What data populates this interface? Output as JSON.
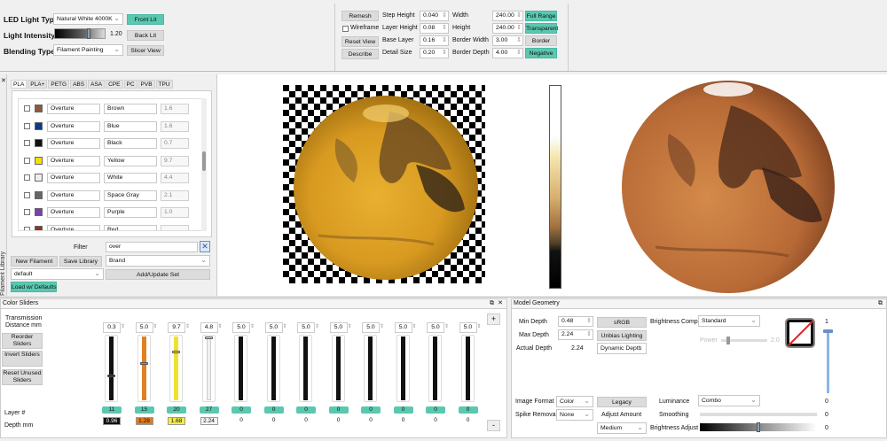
{
  "top_left": {
    "led_label": "LED Light Type",
    "led_value": "Natural White 4000K",
    "front_lit": "Front Lit",
    "intensity_label": "Light Intensity",
    "intensity_value": "1.20",
    "back_lit": "Back Lit",
    "blending_label": "Blending Type",
    "blending_value": "Filament Painting",
    "slicer_view": "Slicer View"
  },
  "top_mid": {
    "remesh": "Remesh",
    "wireframe": "Wireframe",
    "reset_view": "Reset View",
    "describe": "Describe",
    "step_height_label": "Step Height",
    "step_height": "0.040",
    "layer_height_label": "Layer Height",
    "layer_height": "0.08",
    "base_layer_label": "Base Layer",
    "base_layer": "0.16",
    "detail_size_label": "Detail Size",
    "detail_size": "0.20",
    "width_label": "Width",
    "width": "240.00",
    "height_label": "Height",
    "height": "240.00",
    "border_width_label": "Border Width",
    "border_width": "3.00",
    "border_depth_label": "Border Depth",
    "border_depth": "4.00",
    "full_range": "Full Range",
    "transparent": "Transparent",
    "border": "Border",
    "negative": "Negative"
  },
  "library": {
    "side_label": "Filament Library",
    "tabs": [
      "PLA",
      "PLA+",
      "PETG",
      "ABS",
      "ASA",
      "CPE",
      "PC",
      "PVB",
      "TPU"
    ],
    "rows": [
      {
        "brand": "Overture",
        "name": "Brown",
        "td": "1.6",
        "color": "#8b5a3c"
      },
      {
        "brand": "Overture",
        "name": "Blue",
        "td": "1.6",
        "color": "#0a3a8c"
      },
      {
        "brand": "Overture",
        "name": "Black",
        "td": "0.7",
        "color": "#111111"
      },
      {
        "brand": "Overture",
        "name": "Yellow",
        "td": "9.7",
        "color": "#f5e000"
      },
      {
        "brand": "Overture",
        "name": "White",
        "td": "4.4",
        "color": "#eeeeee"
      },
      {
        "brand": "Overture",
        "name": "Space Gray",
        "td": "2.1",
        "color": "#666666"
      },
      {
        "brand": "Overture",
        "name": "Purple",
        "td": "1.0",
        "color": "#7a3fb0"
      },
      {
        "brand": "Overture",
        "name": "Red",
        "td": "",
        "color": "#9a3020"
      }
    ],
    "filter_label": "Filter",
    "filter_value": "over",
    "new_filament": "New Filament",
    "save_library": "Save Library",
    "brand_value": "Brand",
    "set_value": "default",
    "add_update": "Add/Update Set",
    "load_defaults": "Load w/ Defaults"
  },
  "color_sliders": {
    "title": "Color Sliders",
    "transmission": "Transmission Distance mm",
    "reorder": "Reorder Sliders",
    "invert": "Invert Sliders",
    "reset_unused": "Reset Unused Sliders",
    "layer_label": "Layer #",
    "depth_label": "Depth mm",
    "plus": "+",
    "minus": "-",
    "sliders": [
      {
        "td": "0.3",
        "layer": "11",
        "depth": "0.96",
        "track": "#111111",
        "knob": "#111111",
        "depth_bg": "#111111",
        "depth_fg": "#ffffff",
        "level": 0.4
      },
      {
        "td": "5.0",
        "layer": "15",
        "depth": "1.28",
        "track": "#e08020",
        "knob": "#e08020",
        "depth_bg": "#e07a20",
        "depth_fg": "#111111",
        "level": 0.6
      },
      {
        "td": "9.7",
        "layer": "20",
        "depth": "1.68",
        "track": "#f0e030",
        "knob": "#f0e030",
        "depth_bg": "#f5ec40",
        "depth_fg": "#111111",
        "level": 0.78
      },
      {
        "td": "4.8",
        "layer": "27",
        "depth": "2.24",
        "track": "#f0f0f0",
        "knob": "#dddddd",
        "depth_bg": "#f4f4f4",
        "depth_fg": "#111111",
        "level": 1.0
      },
      {
        "td": "5.0",
        "layer": "0",
        "depth": "0"
      },
      {
        "td": "5.0",
        "layer": "0",
        "depth": "0"
      },
      {
        "td": "5.0",
        "layer": "0",
        "depth": "0"
      },
      {
        "td": "5.0",
        "layer": "0",
        "depth": "0"
      },
      {
        "td": "5.0",
        "layer": "0",
        "depth": "0"
      },
      {
        "td": "5.0",
        "layer": "0",
        "depth": "0"
      },
      {
        "td": "5.0",
        "layer": "0",
        "depth": "0"
      },
      {
        "td": "5.0",
        "layer": "0",
        "depth": "0"
      }
    ]
  },
  "model_geometry": {
    "title": "Model Geometry",
    "min_depth_label": "Min Depth",
    "min_depth": "0.48",
    "max_depth_label": "Max Depth",
    "max_depth": "2.24",
    "actual_depth_label": "Actual Depth",
    "actual_depth": "2.24",
    "srgb": "sRGB",
    "unbias": "Unbias Lighting",
    "dynamic_depth": "Dynamic Depth",
    "brightness_comp_label": "Brightness Comp",
    "brightness_comp": "Standard",
    "power_label": "Power",
    "power_value": "2.0",
    "image_format_label": "Image Format",
    "image_format": "Color",
    "legacy": "Legacy",
    "spike_label": "Spike Removal",
    "spike": "None",
    "adjust_amount": "Adjust Amount",
    "adjust_value": "Medium",
    "luminance_label": "Luminance",
    "luminance": "Combo",
    "smoothing_label": "Smoothing",
    "smoothing_value": "0",
    "brightness_adjust_label": "Brightness Adjust",
    "brightness_adjust_value": "0",
    "vslider_top": "1",
    "vslider_bottom": "0"
  }
}
